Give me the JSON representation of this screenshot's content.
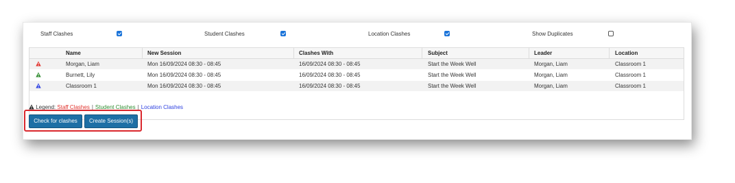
{
  "filters": [
    {
      "label": "Staff Clashes",
      "checked": true
    },
    {
      "label": "Student Clashes",
      "checked": true
    },
    {
      "label": "Location Clashes",
      "checked": true
    },
    {
      "label": "Show Duplicates",
      "checked": false
    }
  ],
  "table": {
    "headers": [
      "Name",
      "New Session",
      "Clashes With",
      "Subject",
      "Leader",
      "Location"
    ],
    "rows": [
      {
        "icon": "warning-icon-red",
        "name": "Morgan, Liam",
        "new_session": "Mon 16/09/2024 08:30 - 08:45",
        "clashes_with": "16/09/2024 08:30 - 08:45",
        "subject": "Start the Week Well",
        "leader": "Morgan, Liam",
        "location": "Classroom 1"
      },
      {
        "icon": "warning-icon-green",
        "name": "Burnett, Lily",
        "new_session": "Mon 16/09/2024 08:30 - 08:45",
        "clashes_with": "16/09/2024 08:30 - 08:45",
        "subject": "Start the Week Well",
        "leader": "Morgan, Liam",
        "location": "Classroom 1"
      },
      {
        "icon": "warning-icon-blue",
        "name": "Classroom 1",
        "new_session": "Mon 16/09/2024 08:30 - 08:45",
        "clashes_with": "16/09/2024 08:30 - 08:45",
        "subject": "Start the Week Well",
        "leader": "Morgan, Liam",
        "location": "Classroom 1"
      }
    ]
  },
  "legend": {
    "prefix": "Legend:",
    "staff": "Staff Clashes",
    "student": "Student Clashes",
    "location": "Location Clashes",
    "separator": "|"
  },
  "buttons": {
    "check": "Check for clashes",
    "create": "Create Session(s)"
  },
  "colors": {
    "staff": "#e0312b",
    "student": "#2e8b2e",
    "location": "#2c3fe0",
    "button": "#1d6fa5",
    "checkbox": "#1a73d9",
    "highlight": "#d9262c"
  }
}
